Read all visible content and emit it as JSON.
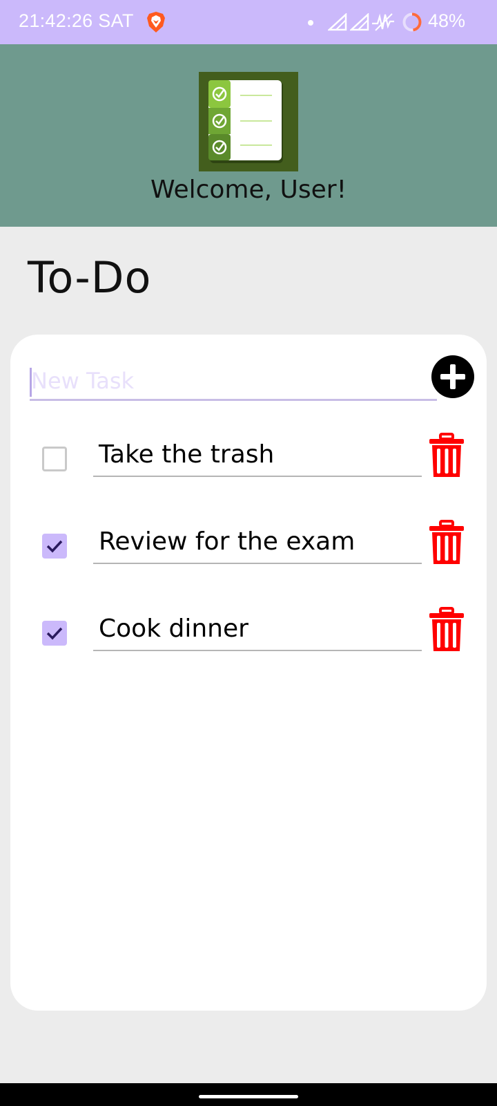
{
  "status_bar": {
    "time": "21:42:26 SAT",
    "battery": "48%",
    "icons": [
      "brave-icon",
      "notification-dot-icon",
      "signal-icon",
      "signal-icon",
      "data-activity-icon",
      "battery-ring-icon"
    ],
    "background_color": "#cbb9fb"
  },
  "header": {
    "logo": "checklist-logo-icon",
    "welcome": "Welcome, User!",
    "background_color": "#6f9a8e"
  },
  "page": {
    "title": "To-Do"
  },
  "new_task": {
    "value": "",
    "placeholder": "New Task",
    "add_icon": "plus-circle-icon"
  },
  "tasks": [
    {
      "text": "Take the trash",
      "checked": false
    },
    {
      "text": "Review for the exam",
      "checked": true
    },
    {
      "text": "Cook dinner",
      "checked": true
    }
  ],
  "colors": {
    "accent": "#cbb9fb",
    "delete": "#ff0000"
  }
}
